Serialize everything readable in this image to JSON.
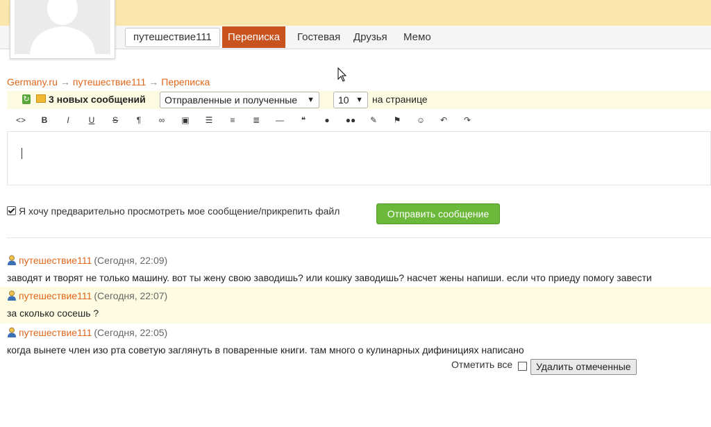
{
  "nav": {
    "username": "путешествие111",
    "tabs": [
      "Переписка",
      "Гостевая",
      "Друзья",
      "Мемо"
    ]
  },
  "breadcrumb": {
    "items": [
      "Germany.ru",
      "путешествие111",
      "Переписка"
    ],
    "separator": "→"
  },
  "filter": {
    "new_messages": "3 новых сообщений",
    "folder_select": "Отправленные и полученные",
    "per_page_select": "10",
    "per_page_label": "на странице"
  },
  "toolbar": {
    "icons": [
      "code-icon",
      "bold-icon",
      "italic-icon",
      "underline-icon",
      "strikethrough-icon",
      "paragraph-icon",
      "link-icon",
      "image-icon",
      "bullet-list-icon",
      "numbered-list-icon",
      "align-icon",
      "horizontal-rule-icon",
      "quote-icon",
      "user-icon",
      "users-icon",
      "chat-icon",
      "flag-icon",
      "smiley-icon",
      "undo-icon",
      "redo-icon"
    ],
    "glyphs": [
      "<>",
      "B",
      "I",
      "U",
      "S",
      "¶",
      "∞",
      "▣",
      "☰",
      "≡",
      "≣",
      "—",
      "❝",
      "●",
      "●●",
      "✎",
      "⚑",
      "☺",
      "↶",
      "↷"
    ]
  },
  "compose": {
    "preview_label": "Я хочу предварительно просмотреть мое сообщение/прикрепить файл",
    "preview_checked": true,
    "send_label": "Отправить сообщение"
  },
  "messages": [
    {
      "author": "путешествие111",
      "time": "(Сегодня, 22:09)",
      "text": "заводят и творят не только машину. вот ты жену свою заводишь? или кошку заводишь? насчет жены напиши. если что приеду помогу завести"
    },
    {
      "author": "путешествие111",
      "time": "(Сегодня, 22:07)",
      "text": "за сколько сосешь ?"
    },
    {
      "author": "путешествие111",
      "time": "(Сегодня, 22:05)",
      "text": "когда вынете член изо рта советую заглянуть в поваренные книги. там много о кулинарных дифинициях написано"
    }
  ],
  "actions": {
    "mark_all": "Отметить все",
    "delete_marked": "Удалить отмеченные"
  },
  "colors": {
    "accent": "#e0661b",
    "active_tab": "#c8531f",
    "send_button": "#6bb83b",
    "highlight_row": "#fcfbe1",
    "top_bar": "#fbe6ad"
  }
}
